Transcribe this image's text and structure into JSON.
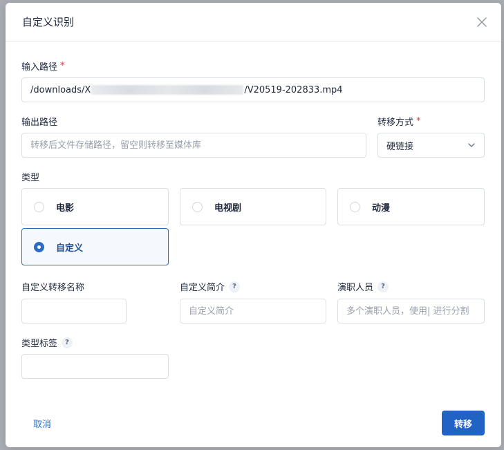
{
  "dialog": {
    "title": "自定义识别",
    "close_icon": "close-icon"
  },
  "input_path": {
    "label": "输入路径",
    "required_mark": "*",
    "value_prefix": "/downloads/X",
    "value_suffix": "/V20519-202833.mp4"
  },
  "output_path": {
    "label": "输出路径",
    "placeholder": "转移后文件存储路径，留空则转移至媒体库"
  },
  "transfer_mode": {
    "label": "转移方式",
    "required_mark": "*",
    "selected": "硬链接",
    "icon": "chevron-down-icon"
  },
  "type": {
    "label": "类型",
    "options": [
      {
        "label": "电影",
        "selected": false
      },
      {
        "label": "电视剧",
        "selected": false
      },
      {
        "label": "动漫",
        "selected": false
      },
      {
        "label": "自定义",
        "selected": true
      }
    ]
  },
  "custom_name": {
    "label": "自定义转移名称",
    "value": ""
  },
  "custom_intro": {
    "label": "自定义简介",
    "help": "?",
    "placeholder": "自定义简介"
  },
  "cast": {
    "label": "演职人员",
    "help": "?",
    "placeholder": "多个演职人员，使用| 进行分割"
  },
  "type_tags": {
    "label": "类型标签",
    "help": "?",
    "value": ""
  },
  "footer": {
    "cancel_label": "取消",
    "submit_label": "转移"
  },
  "colors": {
    "primary": "#2163c4",
    "required": "#d63939",
    "border": "#dadfe5",
    "selected_border": "#2a6bc4"
  }
}
